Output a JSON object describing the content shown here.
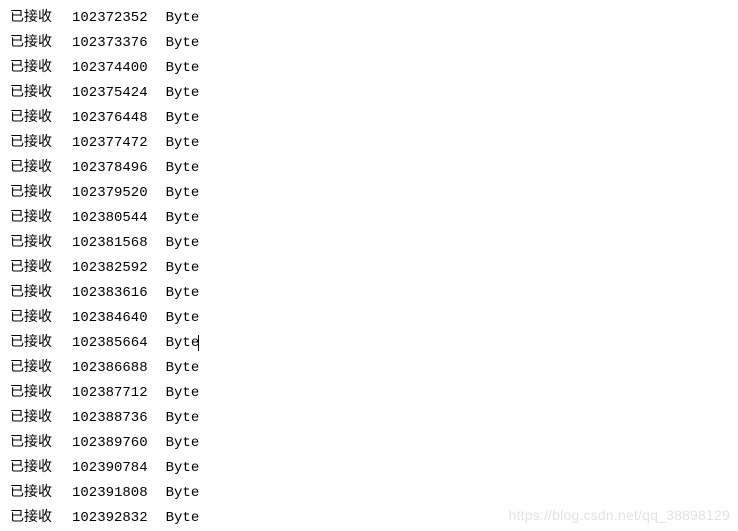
{
  "prefix": "已接收",
  "unit": "Byte",
  "cursor_row": 13,
  "watermark": "https://blog.csdn.net/qq_38898129",
  "rows": [
    {
      "bytes": "102372352"
    },
    {
      "bytes": "102373376"
    },
    {
      "bytes": "102374400"
    },
    {
      "bytes": "102375424"
    },
    {
      "bytes": "102376448"
    },
    {
      "bytes": "102377472"
    },
    {
      "bytes": "102378496"
    },
    {
      "bytes": "102379520"
    },
    {
      "bytes": "102380544"
    },
    {
      "bytes": "102381568"
    },
    {
      "bytes": "102382592"
    },
    {
      "bytes": "102383616"
    },
    {
      "bytes": "102384640"
    },
    {
      "bytes": "102385664"
    },
    {
      "bytes": "102386688"
    },
    {
      "bytes": "102387712"
    },
    {
      "bytes": "102388736"
    },
    {
      "bytes": "102389760"
    },
    {
      "bytes": "102390784"
    },
    {
      "bytes": "102391808"
    },
    {
      "bytes": "102392832"
    }
  ]
}
